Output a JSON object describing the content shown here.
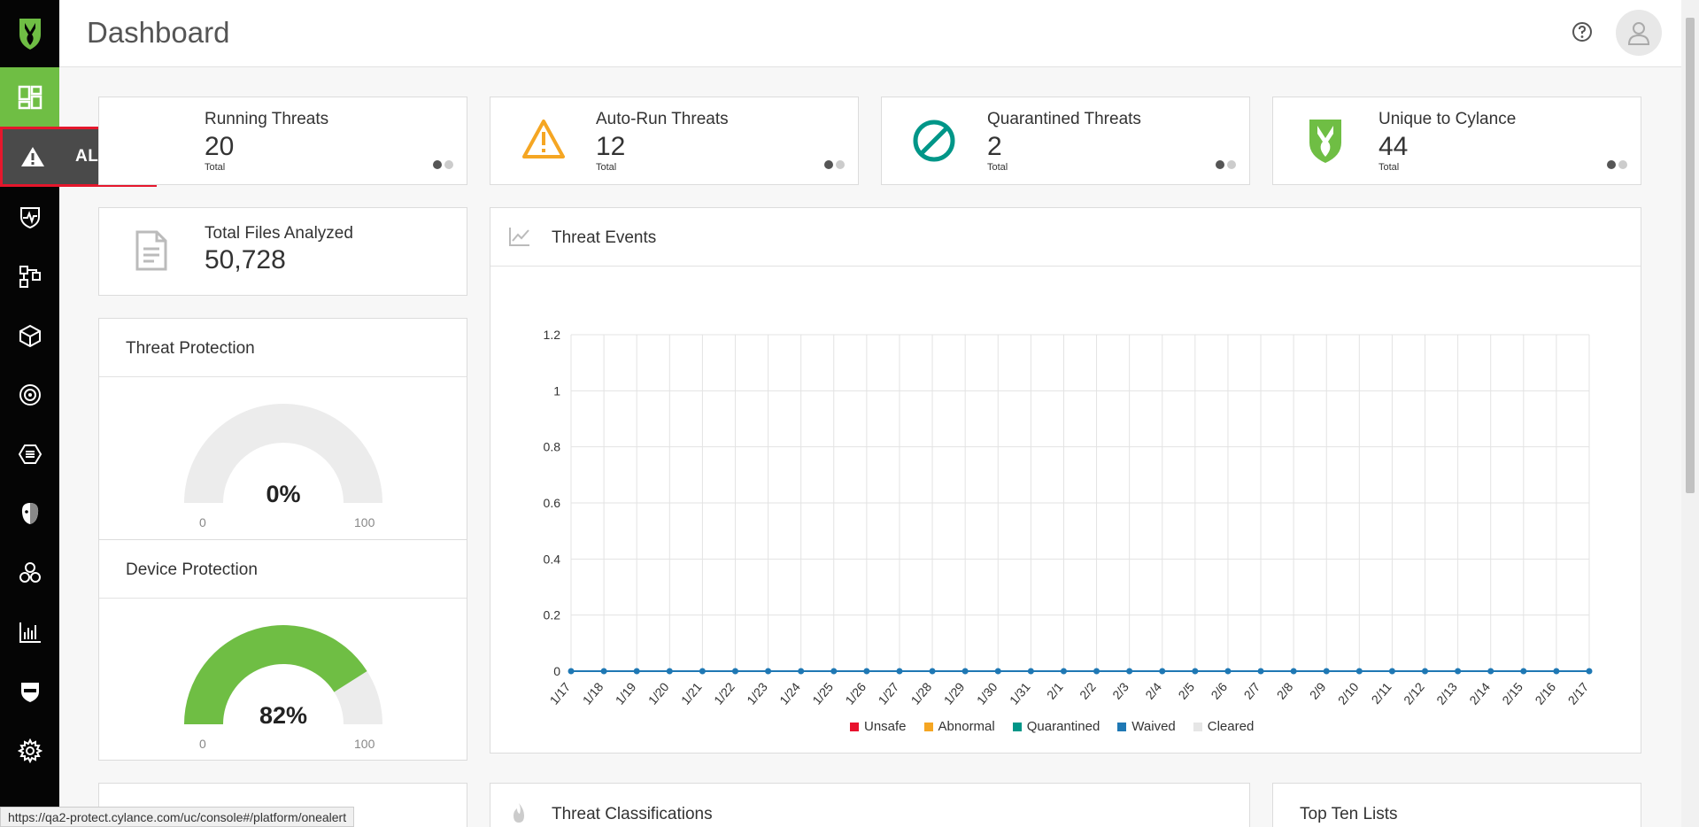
{
  "header": {
    "title": "Dashboard"
  },
  "sidebar": {
    "items": [
      {
        "name": "dashboard",
        "icon": "dashboard-icon"
      },
      {
        "name": "alerts",
        "icon": "alert-icon"
      },
      {
        "name": "protection",
        "icon": "shield-pulse-icon"
      },
      {
        "name": "zones",
        "icon": "network-icon"
      },
      {
        "name": "devices",
        "icon": "cube-icon"
      },
      {
        "name": "optics",
        "icon": "target-icon"
      },
      {
        "name": "policies",
        "icon": "hexagon-icon"
      },
      {
        "name": "persona",
        "icon": "face-icon"
      },
      {
        "name": "integrations",
        "icon": "link-icon"
      },
      {
        "name": "reports",
        "icon": "bar-chart-icon"
      },
      {
        "name": "guard",
        "icon": "shield-mask-icon"
      },
      {
        "name": "settings",
        "icon": "gear-icon"
      }
    ],
    "tooltip": "ALERTS"
  },
  "stats": [
    {
      "title": "Running Threats",
      "value": "20",
      "sub": "Total"
    },
    {
      "title": "Auto-Run Threats",
      "value": "12",
      "sub": "Total"
    },
    {
      "title": "Quarantined Threats",
      "value": "2",
      "sub": "Total"
    },
    {
      "title": "Unique to Cylance",
      "value": "44",
      "sub": "Total"
    }
  ],
  "files": {
    "title": "Total Files Analyzed",
    "value": "50,728"
  },
  "threat_protection": {
    "title": "Threat Protection",
    "value": "0%",
    "min": "0",
    "max": "100",
    "percent": 0
  },
  "device_protection": {
    "title": "Device Protection",
    "value": "82%",
    "min": "0",
    "max": "100",
    "percent": 82
  },
  "threat_events": {
    "title": "Threat Events"
  },
  "threat_classifications": {
    "title": "Threat Classifications"
  },
  "top_ten": {
    "title": "Top Ten Lists"
  },
  "status_url": "https://qa2-protect.cylance.com/uc/console#/platform/onealert",
  "colors": {
    "accent": "#6fbe44",
    "unsafe": "#e8112d",
    "abnormal": "#f5a623",
    "quarantined": "#009688",
    "waived": "#1f78b4",
    "cleared": "#e6e6e6"
  },
  "chart_data": {
    "type": "line",
    "x": [
      "1/17",
      "1/18",
      "1/19",
      "1/20",
      "1/21",
      "1/22",
      "1/23",
      "1/24",
      "1/25",
      "1/26",
      "1/27",
      "1/28",
      "1/29",
      "1/30",
      "1/31",
      "2/1",
      "2/2",
      "2/3",
      "2/4",
      "2/5",
      "2/6",
      "2/7",
      "2/8",
      "2/9",
      "2/10",
      "2/11",
      "2/12",
      "2/13",
      "2/14",
      "2/15",
      "2/16",
      "2/17"
    ],
    "yticks": [
      "0",
      "0.2",
      "0.4",
      "0.6",
      "0.8",
      "1",
      "1.2"
    ],
    "ylim": [
      0,
      1.2
    ],
    "series": [
      {
        "name": "Unsafe",
        "color": "#e8112d",
        "values": [
          0,
          0,
          0,
          0,
          0,
          0,
          0,
          0,
          0,
          0,
          0,
          0,
          0,
          0,
          0,
          0,
          0,
          0,
          0,
          0,
          0,
          0,
          0,
          0,
          0,
          0,
          0,
          0,
          0,
          0,
          0,
          0
        ]
      },
      {
        "name": "Abnormal",
        "color": "#f5a623",
        "values": [
          0,
          0,
          0,
          0,
          0,
          0,
          0,
          0,
          0,
          0,
          0,
          0,
          0,
          0,
          0,
          0,
          0,
          0,
          0,
          0,
          0,
          0,
          0,
          0,
          0,
          0,
          0,
          0,
          0,
          0,
          0,
          0
        ]
      },
      {
        "name": "Quarantined",
        "color": "#009688",
        "values": [
          0,
          0,
          0,
          0,
          0,
          0,
          0,
          0,
          0,
          0,
          0,
          0,
          0,
          0,
          0,
          0,
          0,
          0,
          0,
          0,
          0,
          0,
          0,
          0,
          0,
          0,
          0,
          0,
          0,
          0,
          0,
          0
        ]
      },
      {
        "name": "Waived",
        "color": "#1f78b4",
        "values": [
          0,
          0,
          0,
          0,
          0,
          0,
          0,
          0,
          0,
          0,
          0,
          0,
          0,
          0,
          0,
          0,
          0,
          0,
          0,
          0,
          0,
          0,
          0,
          0,
          0,
          0,
          0,
          0,
          0,
          0,
          0,
          0
        ]
      },
      {
        "name": "Cleared",
        "color": "#e6e6e6",
        "values": [
          0,
          0,
          0,
          0,
          0,
          0,
          0,
          0,
          0,
          0,
          0,
          0,
          0,
          0,
          0,
          0,
          0,
          0,
          0,
          0,
          0,
          0,
          0,
          0,
          0,
          0,
          0,
          0,
          0,
          0,
          0,
          0
        ]
      }
    ],
    "grid": true,
    "legend": "bottom"
  }
}
